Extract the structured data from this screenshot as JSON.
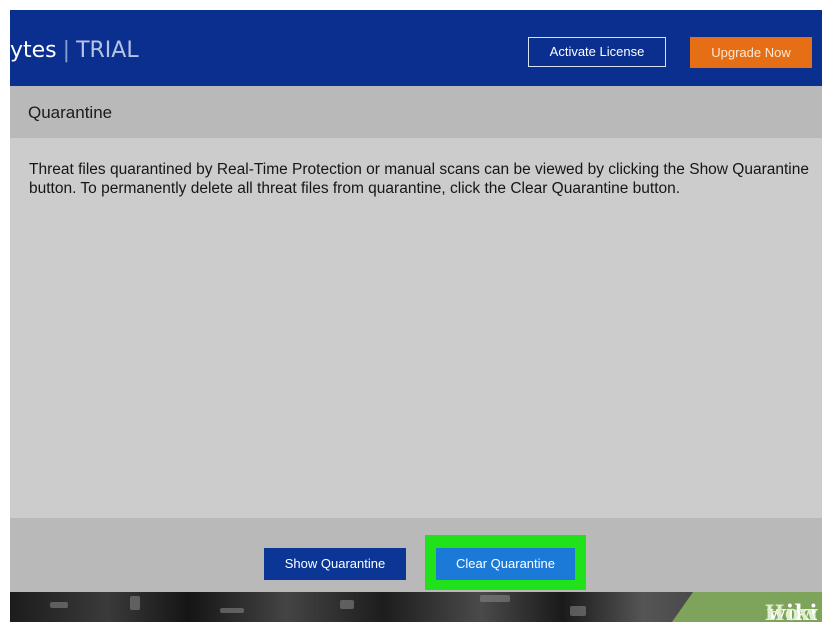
{
  "header": {
    "brand_fragment": "ytes",
    "separator": "|",
    "trial_label": "TRIAL",
    "activate_label": "Activate License",
    "upgrade_label": "Upgrade Now"
  },
  "section": {
    "title": "Quarantine",
    "description": "Threat files quarantined by Real-Time Protection or manual scans can be viewed by clicking the Show Quarantine button. To permanently delete all threat files from quarantine, click the Clear Quarantine button."
  },
  "footer": {
    "show_label": "Show Quarantine",
    "clear_label": "Clear Quarantine"
  },
  "watermark": {
    "wiki": "wiki",
    "how": "How"
  },
  "colors": {
    "header_bg": "#0b2f8f",
    "upgrade_bg": "#e66f16",
    "show_bg": "#0b3696",
    "clear_bg": "#1b7ad8",
    "highlight": "#21e11b"
  }
}
